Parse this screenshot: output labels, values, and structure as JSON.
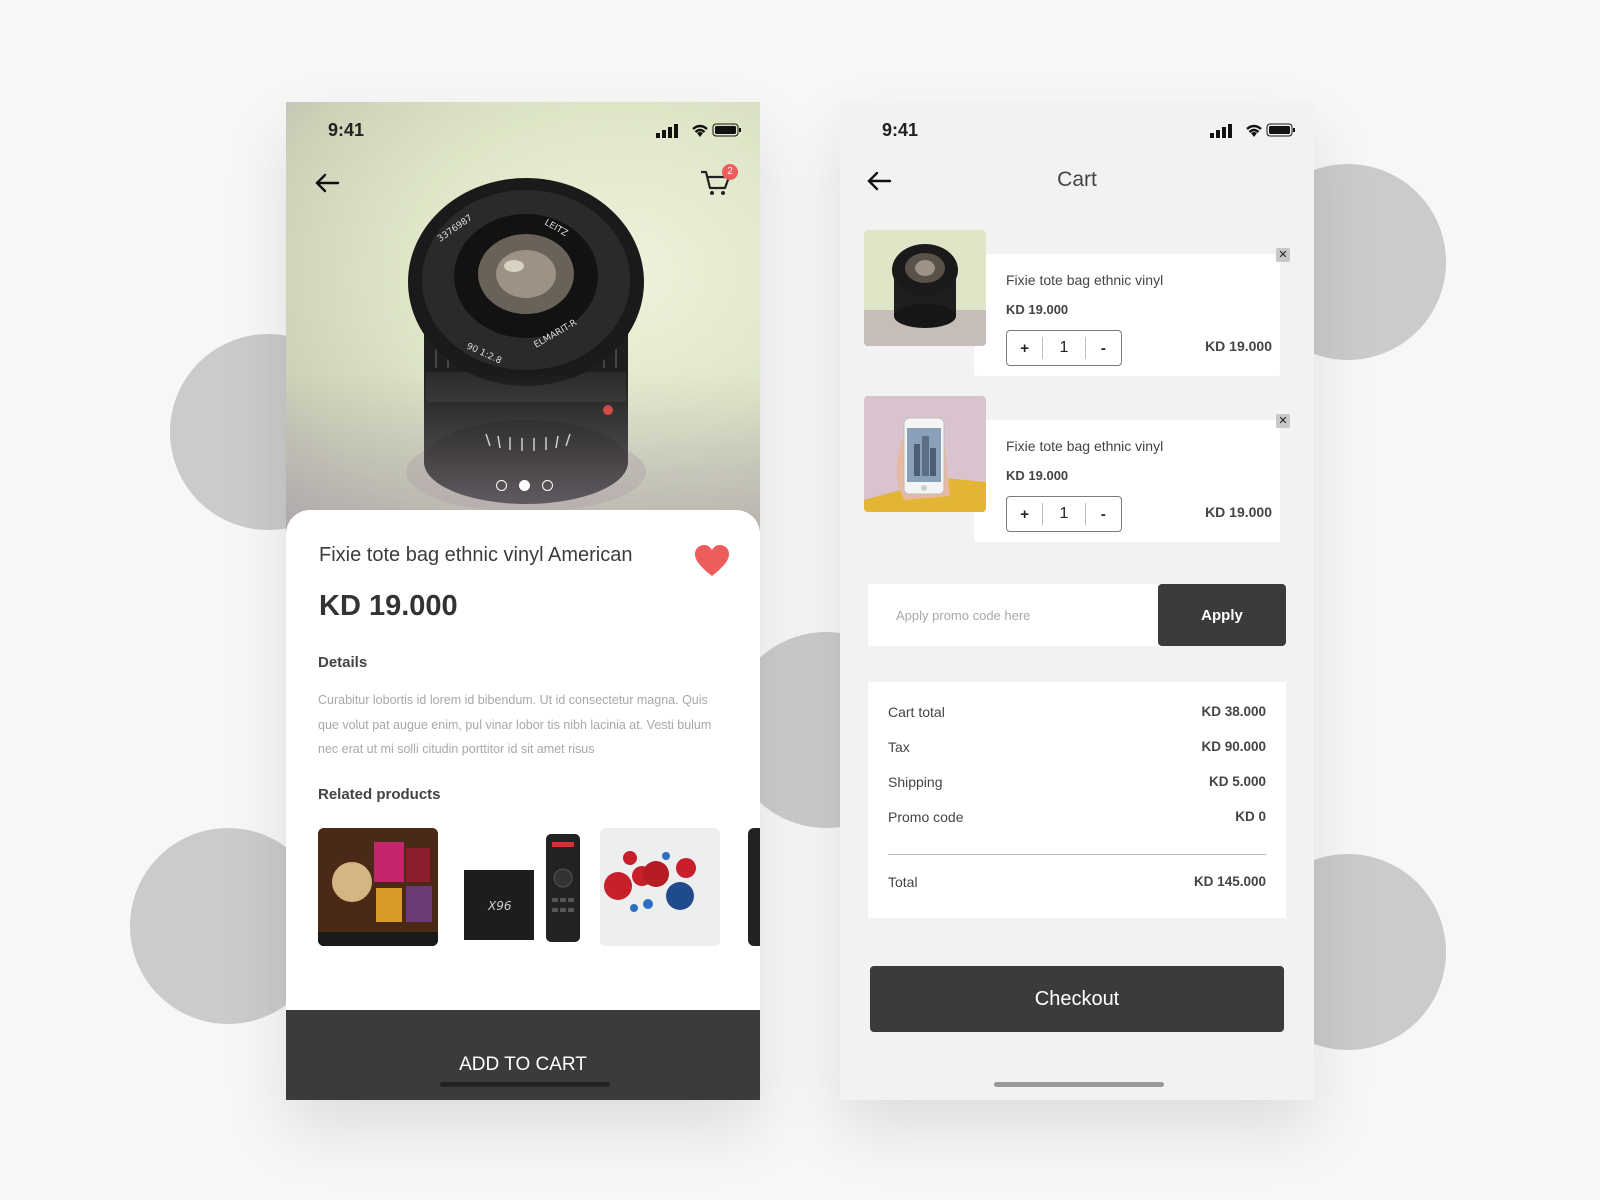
{
  "product_screen": {
    "status_time": "9:41",
    "cart_badge_count": "2",
    "carousel_active_index": 1,
    "title": "Fixie tote bag ethnic vinyl American",
    "price": "KD 19.000",
    "details_heading": "Details",
    "details_text": "Curabitur lobortis id lorem id bibendum. Ut id consectetur magna. Quis que volut pat augue enim, pul vinar lobor tis nibh lacinia at. Vesti bulum nec erat ut mi solli citudin porttitor id sit amet risus",
    "related_heading": "Related products",
    "add_to_cart_label": "ADD TO CART",
    "favorited": true
  },
  "cart_screen": {
    "status_time": "9:41",
    "title": "Cart",
    "items": [
      {
        "name": "Fixie tote bag ethnic vinyl",
        "price": "KD 19.000",
        "qty": "1",
        "line_total": "KD 19.000",
        "plus": "+",
        "minus": "-",
        "remove": "✕"
      },
      {
        "name": "Fixie tote bag ethnic vinyl",
        "price": "KD 19.000",
        "qty": "1",
        "line_total": "KD 19.000",
        "plus": "+",
        "minus": "-",
        "remove": "✕"
      }
    ],
    "promo_placeholder": "Apply promo code here",
    "apply_label": "Apply",
    "summary": {
      "cart_total_label": "Cart total",
      "cart_total": "KD 38.000",
      "tax_label": "Tax",
      "tax": "KD 90.000",
      "shipping_label": "Shipping",
      "shipping": "KD 5.000",
      "promo_label": "Promo code",
      "promo": "KD 0",
      "total_label": "Total",
      "total": "KD 145.000"
    },
    "checkout_label": "Checkout"
  },
  "colors": {
    "dark_button": "#3b3b3b",
    "heart": "#ef5c5c",
    "background": "#f7f7f7",
    "blob": "#cbcbcb"
  },
  "icons": [
    "back-arrow-icon",
    "cart-icon",
    "heart-icon",
    "signal-icon",
    "wifi-icon",
    "battery-icon",
    "close-icon"
  ]
}
